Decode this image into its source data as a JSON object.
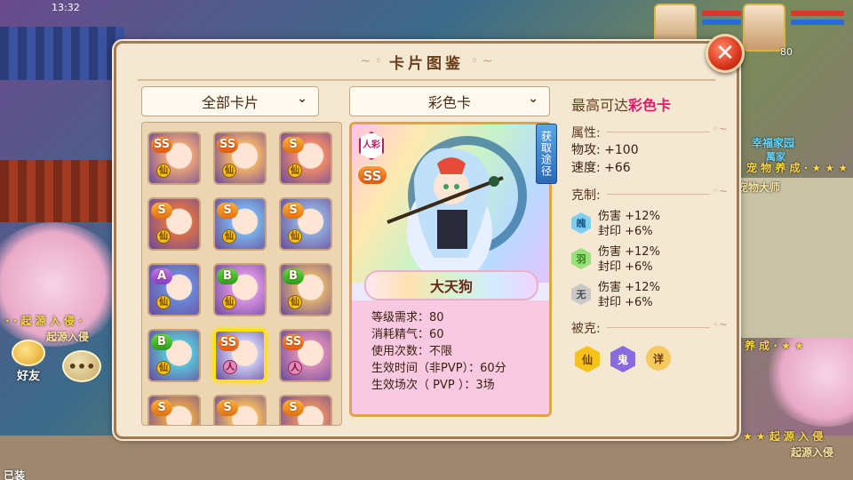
{
  "status": {
    "time": "13:32"
  },
  "hud": {
    "level": "80"
  },
  "scene": {
    "friend_label": "好友",
    "chat_icon": "speech-bubble-icon",
    "text_left_1": "· · 起 源 入 侵 ·",
    "text_left_2": "起源入侵",
    "text_right_1": "宠 物 养 成 · ★ ★ ★",
    "text_right_2": "宠物大师",
    "text_right_3": "幸福家园",
    "text_right_4": "萬家",
    "text_right_5": "养 成 · ★ ★",
    "text_right_6": "★ ★ 起 源 入 侵",
    "text_right_7": "起源入侵",
    "text_bottom": "已装"
  },
  "dialog": {
    "title": "卡片图鉴",
    "close_icon": "close-icon"
  },
  "left": {
    "filter_label": "全部卡片",
    "cards": [
      {
        "rank": "SS",
        "type": "仙",
        "face": "#e9a27a"
      },
      {
        "rank": "SS",
        "type": "仙",
        "face": "#f1b06a"
      },
      {
        "rank": "S",
        "type": "仙",
        "face": "#f08a6a"
      },
      {
        "rank": "S",
        "type": "仙",
        "face": "#d8704a"
      },
      {
        "rank": "S",
        "type": "仙",
        "face": "#7ab0e8"
      },
      {
        "rank": "S",
        "type": "仙",
        "face": "#8fa8d8"
      },
      {
        "rank": "A",
        "type": "仙",
        "face": "#6a88d8"
      },
      {
        "rank": "B",
        "type": "仙",
        "face": "#d890e0"
      },
      {
        "rank": "B",
        "type": "仙",
        "face": "#e0b070"
      },
      {
        "rank": "B",
        "type": "仙",
        "face": "#5ac0d8"
      },
      {
        "rank": "SS",
        "type": "人",
        "face": "#c8c8f0"
      },
      {
        "rank": "SS",
        "type": "人",
        "face": "#d88ab8"
      },
      {
        "rank": "S",
        "type": "仙",
        "face": "#e0a050"
      },
      {
        "rank": "S",
        "type": "仙",
        "face": "#f0b860"
      },
      {
        "rank": "S",
        "type": "仙",
        "face": "#e08a6a"
      }
    ]
  },
  "middle": {
    "filter_label": "彩色卡",
    "rank": "SS",
    "type_label": "人彩",
    "obtain_label": "获取途径",
    "card_name": "大天狗",
    "stats": [
      "等级需求：80",
      "消耗精气：60",
      "使用次数：不限",
      "生效时间（非PVP）：60分",
      "生效场次（ PVP ）：3场"
    ]
  },
  "right": {
    "max_prefix": "最高可达",
    "max_highlight": "彩色卡",
    "attr_head": "属性:",
    "attrs": [
      "物攻: +100",
      "速度: +66"
    ],
    "counter_head": "克制:",
    "counters": [
      {
        "icon": "魄",
        "color": "#7fd0f0",
        "text_color": "#1a5a8a",
        "line1": "伤害 +12%",
        "line2": "封印 +6%"
      },
      {
        "icon": "羽",
        "color": "#9ae07a",
        "text_color": "#2a7a18",
        "line1": "伤害 +12%",
        "line2": "封印 +6%"
      },
      {
        "icon": "无",
        "color": "#c8c8c8",
        "text_color": "#4a4a4a",
        "line1": "伤害 +12%",
        "line2": "封印 +6%"
      }
    ],
    "weak_head": "被克:",
    "weak": [
      {
        "icon": "仙",
        "color": "#f6c21a",
        "text_color": "#6a3a00"
      },
      {
        "icon": "鬼",
        "color": "#8a6ae0",
        "text_color": "#fff"
      },
      {
        "icon": "详",
        "color": "#f6c860",
        "text_color": "#6a3a00"
      }
    ]
  }
}
